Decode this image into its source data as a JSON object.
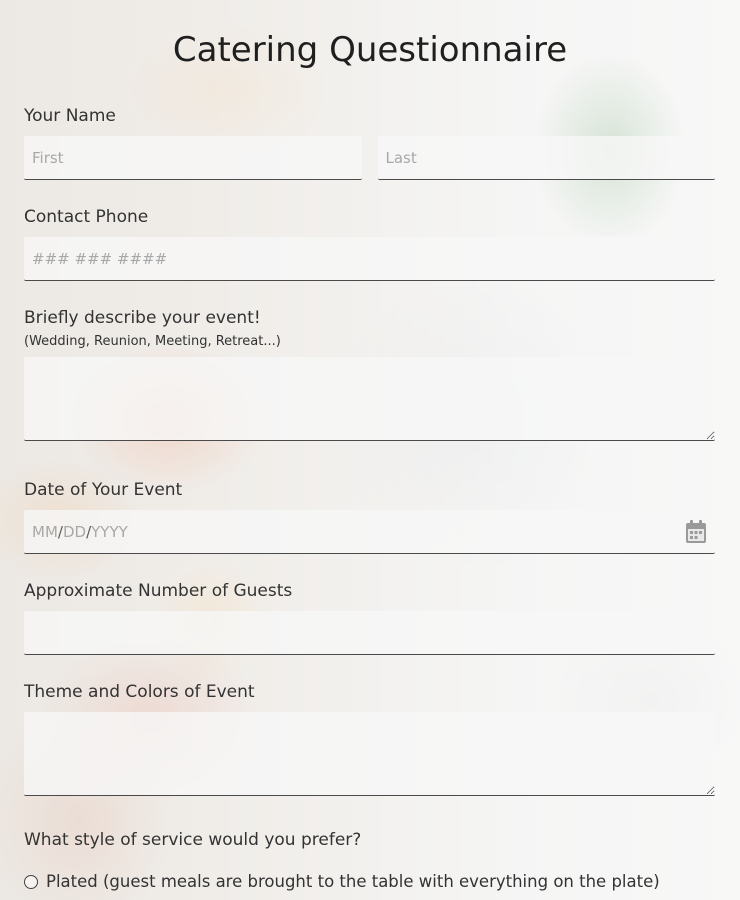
{
  "form": {
    "title": "Catering Questionnaire",
    "name": {
      "label": "Your Name",
      "first_placeholder": "First",
      "last_placeholder": "Last"
    },
    "phone": {
      "label": "Contact Phone",
      "placeholder": "### ### ####"
    },
    "event_description": {
      "label": "Briefly describe your event!",
      "sublabel": "(Wedding, Reunion, Meeting, Retreat...)"
    },
    "event_date": {
      "label": "Date of Your Event",
      "placeholder_month": "MM",
      "placeholder_day": "DD",
      "placeholder_year": "YYYY",
      "separator": "/",
      "icon": "calendar-icon"
    },
    "guests": {
      "label": "Approximate Number of Guests"
    },
    "theme": {
      "label": "Theme and Colors of Event"
    },
    "service_style": {
      "label": "What style of service would you prefer?",
      "options": [
        {
          "label": "Plated (guest meals are brought to the table with everything on the plate)"
        }
      ]
    }
  }
}
